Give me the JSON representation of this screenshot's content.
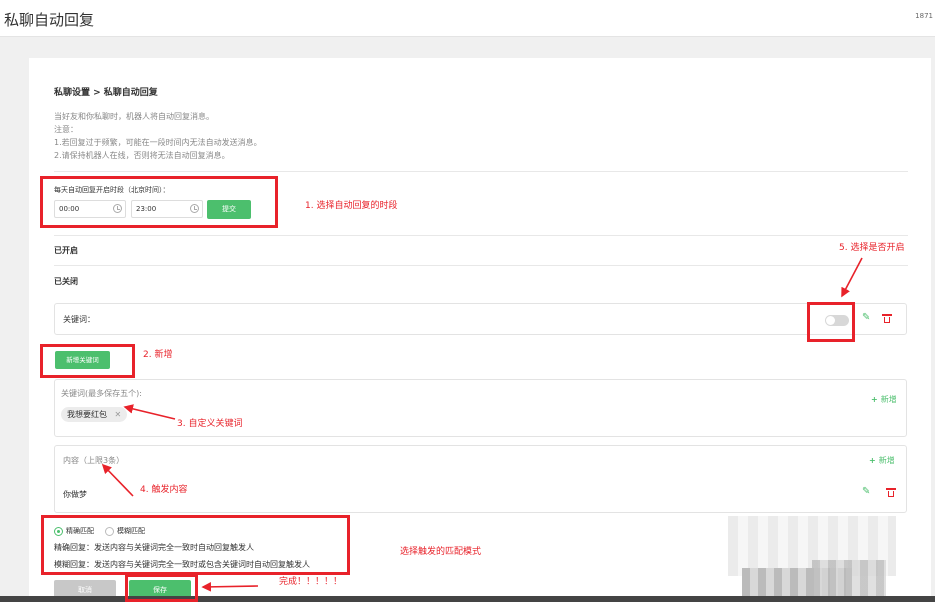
{
  "header": {
    "title": "私聊自动回复",
    "corner_num": "1871"
  },
  "breadcrumb": "私聊设置 > 私聊自动回复",
  "intro": {
    "line1": "当好友和你私聊时，机器人将自动回复消息。",
    "line2": "注意：",
    "line3": "1.若回复过于频繁，可能在一段时间内无法自动发送消息。",
    "line4": "2.请保持机器人在线，否则将无法自动回复消息。"
  },
  "time": {
    "label": "每天自动回复开启时段（北京时间）：",
    "start": "00:00",
    "end": "23:00",
    "submit": "提交"
  },
  "sections": {
    "enabled": "已开启",
    "disabled": "已关闭"
  },
  "rule": {
    "keyword_label": "关键词：",
    "switch_on": false
  },
  "add_keyword_btn": "新增关键词",
  "keywords_box": {
    "label": "关键词(最多保存五个):",
    "add": "新增",
    "tags": [
      "我想要红包"
    ]
  },
  "content_box": {
    "label": "内容（上限3条）",
    "add": "新增",
    "items": [
      "你做梦"
    ]
  },
  "match": {
    "exact_label": "精确匹配",
    "fuzzy_label": "模糊匹配",
    "selected": "exact",
    "exact_desc": "精确回复：发送内容与关键词完全一致时自动回复触发人",
    "fuzzy_desc": "模糊回复：发送内容与关键词完全一致时或包含关键词时自动回复触发人"
  },
  "footer": {
    "cancel": "取消",
    "save": "保存"
  },
  "annotations": {
    "a1": "1. 选择自动回复的时段",
    "a2": "2. 新增",
    "a3": "3. 自定义关键词",
    "a4": "4. 触发内容",
    "a5": "5. 选择是否开启",
    "a6": "选择触发的匹配模式",
    "a7": "完成！！！！！"
  },
  "colors": {
    "accent": "#4cbf6d",
    "annotation": "#e8222a"
  }
}
